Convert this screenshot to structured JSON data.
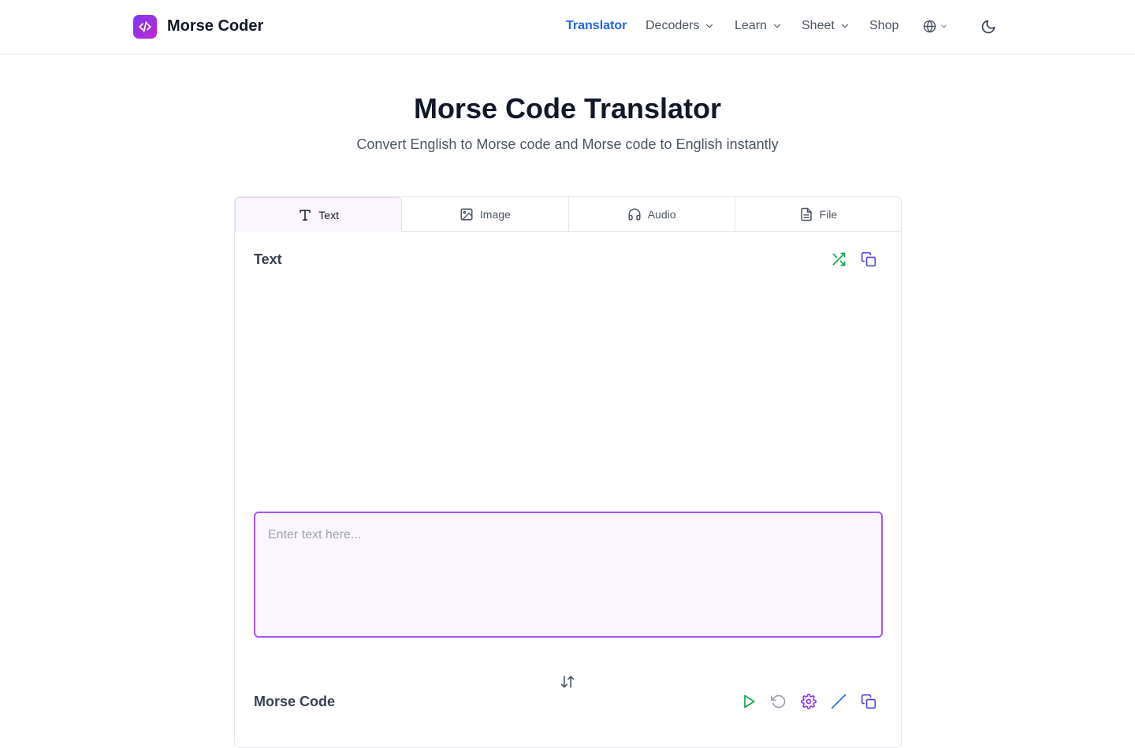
{
  "header": {
    "brand": "Morse Coder",
    "nav": [
      {
        "label": "Translator",
        "active": true,
        "dropdown": false
      },
      {
        "label": "Decoders",
        "active": false,
        "dropdown": true
      },
      {
        "label": "Learn",
        "active": false,
        "dropdown": true
      },
      {
        "label": "Sheet",
        "active": false,
        "dropdown": true
      },
      {
        "label": "Shop",
        "active": false,
        "dropdown": false
      }
    ],
    "icons": [
      "code-icon",
      "globe-icon",
      "chevron-down-icon",
      "moon-icon"
    ]
  },
  "hero": {
    "title": "Morse Code Translator",
    "subtitle": "Convert English to Morse code and Morse code to English instantly"
  },
  "tabs": [
    {
      "label": "Text",
      "icon": "type-icon",
      "active": true
    },
    {
      "label": "Image",
      "icon": "image-icon",
      "active": false
    },
    {
      "label": "Audio",
      "icon": "headphones-icon",
      "active": false
    },
    {
      "label": "File",
      "icon": "file-icon",
      "active": false
    }
  ],
  "input_section": {
    "label": "Text",
    "placeholder": "Enter text here...",
    "value": "",
    "actions": [
      "shuffle-icon",
      "copy-icon"
    ]
  },
  "output_section": {
    "label": "Morse Code",
    "actions": [
      "play-icon",
      "reset-icon",
      "settings-icon",
      "slash-icon",
      "copy-icon"
    ]
  },
  "colors": {
    "accent_purple": "#a855f7",
    "nav_active": "#2563eb",
    "green": "#16a34a",
    "indigo": "#4f46e5"
  }
}
